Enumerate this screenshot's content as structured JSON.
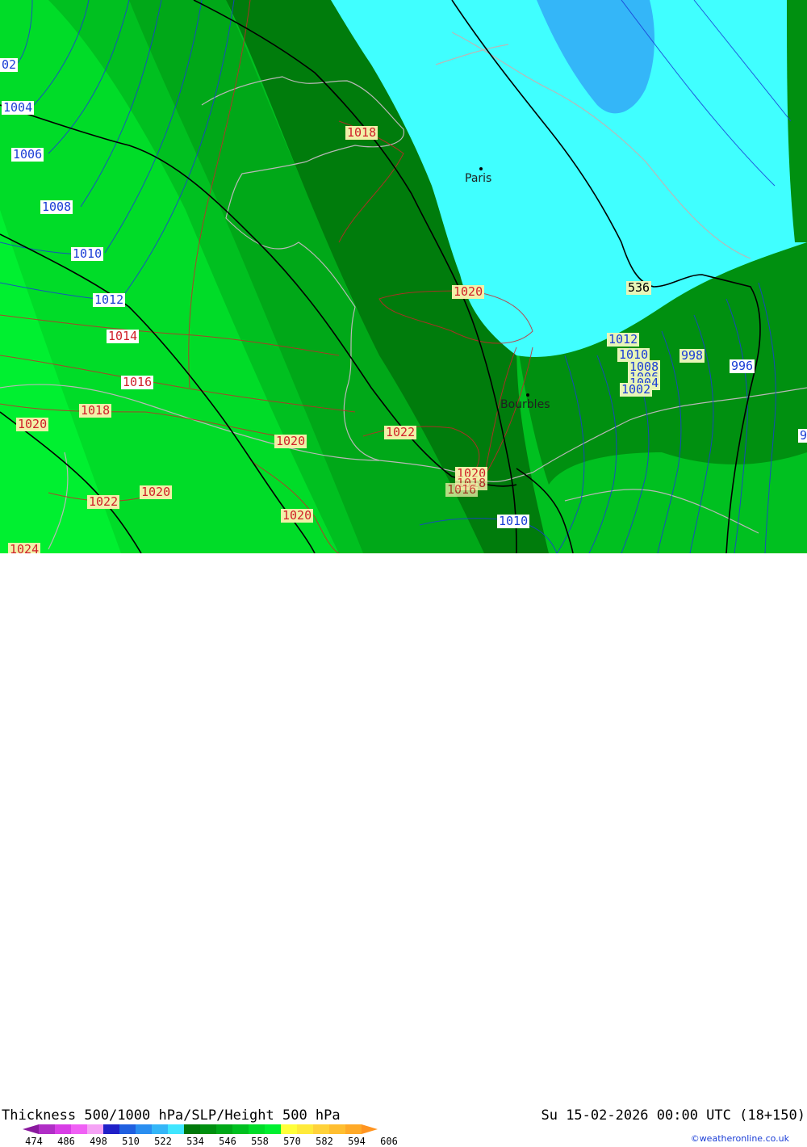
{
  "title": "Thickness 500/1000 hPa/SLP/Height 500 hPa",
  "datetime": "Su 15-02-2026 00:00 UTC (18+150)",
  "credit": "©weatheronline.co.uk",
  "cities": [
    {
      "name": "Paris"
    },
    {
      "name": "Bourbles"
    }
  ],
  "height_label": "536",
  "isobar_labels": {
    "l1002": "02",
    "l1004": "1004",
    "l1006": "1006",
    "l1008": "1008",
    "l1010": "1010",
    "l1012": "1012",
    "l1014": "1014",
    "l1016": "1016",
    "l1018a": "1018",
    "l1018b": "1018",
    "l1020a": "1020",
    "l1020b": "1020",
    "l1020c": "1020",
    "l1020d": "1020",
    "l1020e": "1020",
    "l1020f": "1020",
    "l1022a": "1022",
    "l1022b": "1022",
    "l1012e": "1012",
    "l1010e": "1010",
    "l1008e": "1008",
    "l1006e": "1006",
    "l1004e": "1004",
    "l1002e": "1002",
    "l998": "998",
    "l996": "996",
    "l9": "9",
    "l1010s": "1010",
    "l1016s": "1016",
    "l1018s": "1018",
    "l1024": "1024"
  },
  "scale": {
    "ticks": [
      "474",
      "486",
      "498",
      "510",
      "522",
      "534",
      "546",
      "558",
      "570",
      "582",
      "594",
      "606"
    ],
    "colors": [
      "#8a1a9e",
      "#b02ec6",
      "#d83ee6",
      "#f060f5",
      "#f5a3f5",
      "#2020c8",
      "#2060e0",
      "#2a8ef0",
      "#34b6f8",
      "#40e6ff",
      "#00780a",
      "#009010",
      "#00a818",
      "#00c020",
      "#00dc28",
      "#00f030",
      "#ffff3a",
      "#ffea3a",
      "#ffd23a",
      "#ffbe30",
      "#ffaa28",
      "#ff9420"
    ]
  },
  "colors": {
    "isobar": "#1a3dd6",
    "isobar_high": "#d0202a",
    "height_line": "#000000",
    "coastline": "#b8b8b8"
  }
}
